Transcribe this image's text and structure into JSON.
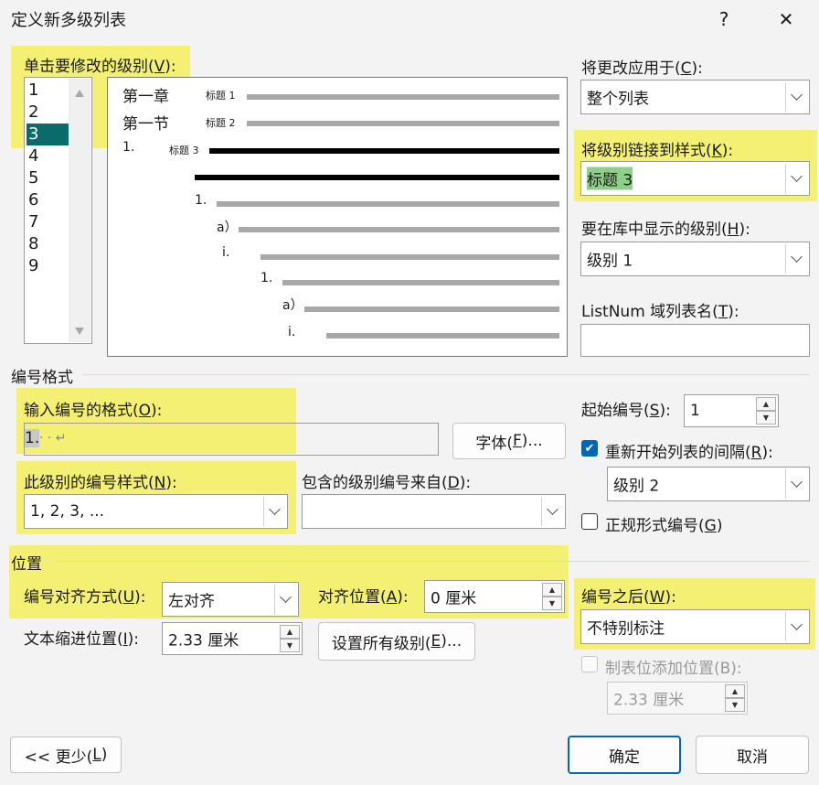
{
  "window": {
    "title": "定义新多级列表",
    "help_icon": "?",
    "close_icon": "✕"
  },
  "level_list": {
    "label_pre": "单击要修改的级别(",
    "label_key": "V",
    "label_post": "):",
    "items": [
      "1",
      "2",
      "3",
      "4",
      "5",
      "6",
      "7",
      "8",
      "9"
    ],
    "selected": "3"
  },
  "preview": {
    "chapter": "第一章",
    "section": "第一节",
    "number": "1.",
    "style1": "标题 1",
    "style2": "标题 2",
    "style3": "标题 3",
    "sub_numbers": [
      "1.",
      "a）",
      "i.",
      "1.",
      "a）",
      "i."
    ]
  },
  "apply_to": {
    "label_pre": "将更改应用于(",
    "label_key": "C",
    "label_post": "):",
    "value": "整个列表"
  },
  "link_style": {
    "label_pre": "将级别链接到样式(",
    "label_key": "K",
    "label_post": "):",
    "value": "标题 3"
  },
  "gallery_level": {
    "label_pre": "要在库中显示的级别(",
    "label_key": "H",
    "label_post": "):",
    "value": "级别 1"
  },
  "listnum": {
    "label_pre": "ListNum 域列表名(",
    "label_key": "T",
    "label_post": "):",
    "value": ""
  },
  "number_format": {
    "section_title": "编号格式",
    "format_label_pre": "输入编号的格式(",
    "format_label_key": "O",
    "format_label_post": "):",
    "format_value": "1.",
    "format_marks": "· · ↵",
    "font_button_pre": "字体(",
    "font_button_key": "F",
    "font_button_post": ")...",
    "style_label_pre": "此级别的编号样式(",
    "style_label_key": "N",
    "style_label_post": "):",
    "style_value": "1, 2, 3, ...",
    "include_label_pre": "包含的级别编号来自(",
    "include_label_key": "D",
    "include_label_post": "):",
    "include_value": "",
    "start_label_pre": "起始编号(",
    "start_label_key": "S",
    "start_label_post": "):",
    "start_value": "1",
    "restart_label_pre": "重新开始列表的间隔(",
    "restart_label_key": "R",
    "restart_label_post": "):",
    "restart_checked": true,
    "restart_value": "级别 2",
    "legal_label_pre": "正规形式编号(",
    "legal_label_key": "G",
    "legal_label_post": ")",
    "legal_checked": false
  },
  "position": {
    "section_title": "位置",
    "align_label_pre": "编号对齐方式(",
    "align_label_key": "U",
    "align_label_post": "):",
    "align_value": "左对齐",
    "aligned_at_label_pre": "对齐位置(",
    "aligned_at_label_key": "A",
    "aligned_at_label_post": "):",
    "aligned_at_value": "0 厘米",
    "indent_label_pre": "文本缩进位置(",
    "indent_label_key": "I",
    "indent_label_post": "):",
    "indent_value": "2.33 厘米",
    "set_all_pre": "设置所有级别(",
    "set_all_key": "E",
    "set_all_post": ")...",
    "follow_label_pre": "编号之后(",
    "follow_label_key": "W",
    "follow_label_post": "):",
    "follow_value": "不特别标注",
    "tab_label": "制表位添加位置(B):",
    "tab_checked": false,
    "tab_value": "2.33 厘米"
  },
  "footer": {
    "less_pre": "<< 更少(",
    "less_key": "L",
    "less_post": ")",
    "ok": "确定",
    "cancel": "取消"
  },
  "colors": {
    "highlight": "#f3ef6b",
    "selection": "#0a6b6b",
    "accent": "#0066b4"
  }
}
